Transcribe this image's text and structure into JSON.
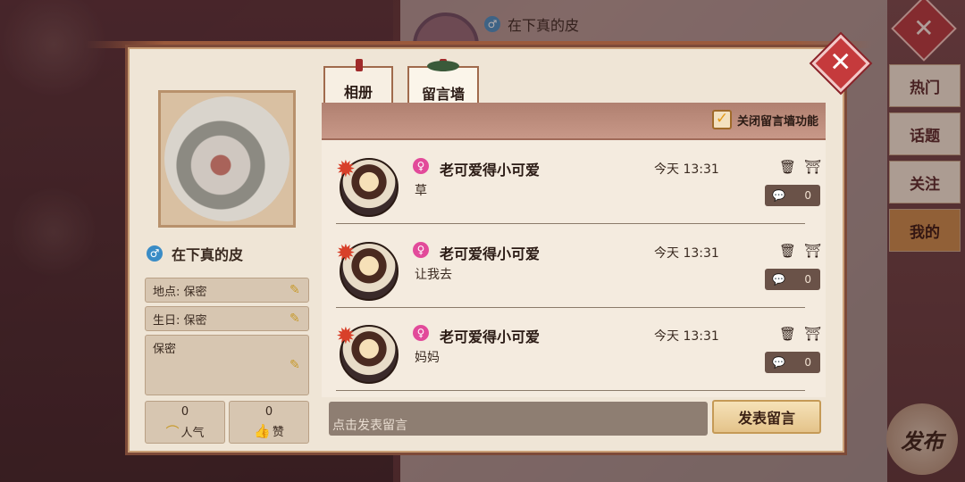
{
  "background": {
    "owner_name": "在下真的皮"
  },
  "sidebar": {
    "close_icon": "close-icon",
    "items": [
      {
        "label": "热门",
        "active": false
      },
      {
        "label": "话题",
        "active": false
      },
      {
        "label": "关注",
        "active": false
      },
      {
        "label": "我的",
        "active": true
      }
    ],
    "publish_label": "发布"
  },
  "profile": {
    "name": "在下真的皮",
    "gender": "male",
    "location_label": "地点: 保密",
    "birthday_label": "生日: 保密",
    "bio": "保密",
    "popularity": {
      "value": "0",
      "label": "人气"
    },
    "likes": {
      "value": "0",
      "label": "赞"
    }
  },
  "tabs": [
    {
      "label": "相册",
      "active": false
    },
    {
      "label": "留言墙",
      "active": true
    }
  ],
  "wall": {
    "toggle_label": "关闭留言墙功能",
    "toggle_checked": true,
    "messages": [
      {
        "author": "老可爱得小可爱",
        "gender": "female",
        "time": "今天 13:31",
        "text": "草",
        "replies": "0"
      },
      {
        "author": "老可爱得小可爱",
        "gender": "female",
        "time": "今天 13:31",
        "text": "让我去",
        "replies": "0"
      },
      {
        "author": "老可爱得小可爱",
        "gender": "female",
        "time": "今天 13:31",
        "text": "妈妈",
        "replies": "0"
      }
    ],
    "input_placeholder": "点击发表留言",
    "post_label": "发表留言"
  },
  "colors": {
    "accent_red": "#c53a3c",
    "male_blue": "#3a8cc6",
    "female_pink": "#e24a9a",
    "gold": "#c79a2b"
  }
}
